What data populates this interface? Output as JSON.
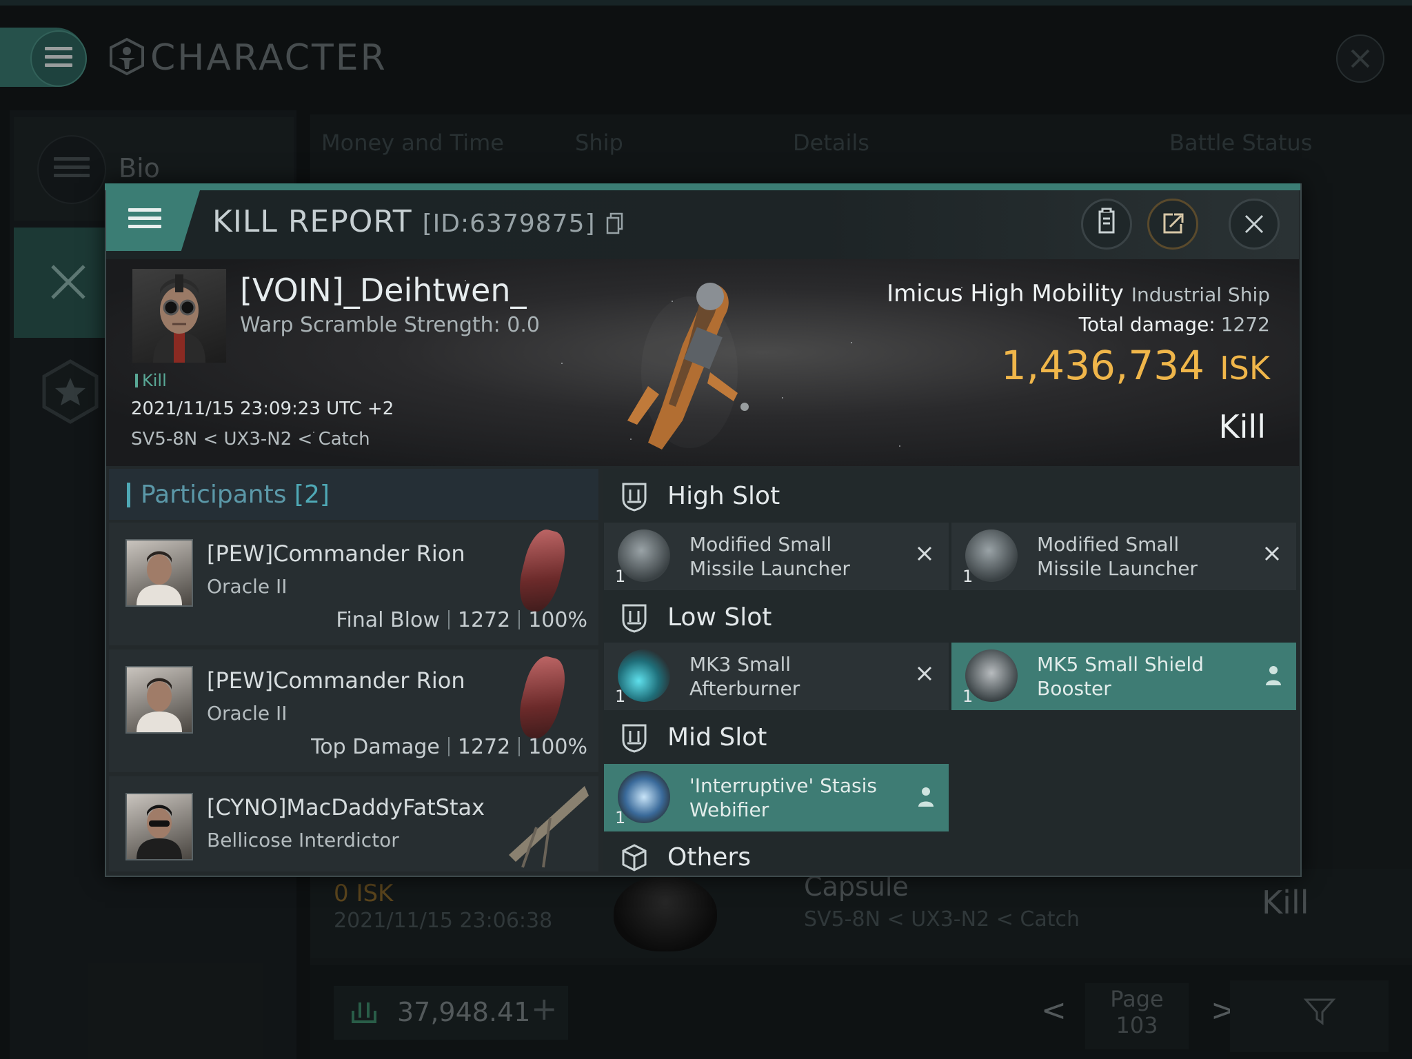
{
  "app": {
    "title": "CHARACTER",
    "nav": {
      "bio_label": "Bio"
    },
    "columns": [
      "Money and Time",
      "Ship",
      "Details",
      "Battle Status"
    ],
    "background_row": {
      "isk": "0 ISK",
      "date": "2021/11/15 23:06:38",
      "ship": "Capsule",
      "route": "SV5-8N < UX3-N2 < Catch",
      "status": "Kill"
    },
    "wallet": {
      "value": "37,948.41",
      "plus": "+"
    },
    "pager": {
      "label": "Page",
      "number": "103",
      "prev": "<",
      "next": ">"
    }
  },
  "kill_report": {
    "title": "KILL REPORT",
    "id": "[ID:6379875]",
    "victim": {
      "name": "[VOIN]_Deihtwen_",
      "warp_scramble": "Warp Scramble Strength: 0.0",
      "tag": "Kill",
      "datetime": "2021/11/15 23:09:23 UTC +2",
      "route": "SV5-8N < UX3-N2 < Catch"
    },
    "ship": {
      "name": "Imicus High Mobility",
      "class": "Industrial Ship"
    },
    "total_damage_label": "Total damage:",
    "total_damage": "1272",
    "isk_value": "1,436,734",
    "isk_unit": "ISK",
    "result": "Kill"
  },
  "participants": {
    "title": "Participants",
    "count": "[2]",
    "rows": [
      {
        "name": "[PEW]Commander Rion",
        "ship": "Oracle II",
        "role": "Final Blow",
        "damage": "1272",
        "percent": "100%"
      },
      {
        "name": "[PEW]Commander Rion",
        "ship": "Oracle II",
        "role": "Top Damage",
        "damage": "1272",
        "percent": "100%"
      },
      {
        "name": "[CYNO]MacDaddyFatStax",
        "ship": "Bellicose Interdictor"
      }
    ]
  },
  "fitting": {
    "high": {
      "title": "High Slot",
      "modules": [
        {
          "qty": "1",
          "line1": "Modified Small",
          "line2": "Missile Launcher",
          "state": "destroyed"
        },
        {
          "qty": "1",
          "line1": "Modified Small",
          "line2": "Missile Launcher",
          "state": "destroyed"
        }
      ]
    },
    "low": {
      "title": "Low Slot",
      "modules": [
        {
          "qty": "1",
          "line1": "MK3 Small",
          "line2": "Afterburner",
          "state": "destroyed"
        },
        {
          "qty": "1",
          "line1": "MK5 Small Shield",
          "line2": "Booster",
          "state": "dropped"
        }
      ]
    },
    "mid": {
      "title": "Mid Slot",
      "modules": [
        {
          "qty": "1",
          "line1": "'Interruptive' Stasis",
          "line2": "Webifier",
          "state": "dropped"
        }
      ]
    },
    "others": {
      "title": "Others"
    }
  },
  "colors": {
    "accent": "#3b7d74",
    "isk": "#f0b64a",
    "participants": "#5b98a8"
  }
}
